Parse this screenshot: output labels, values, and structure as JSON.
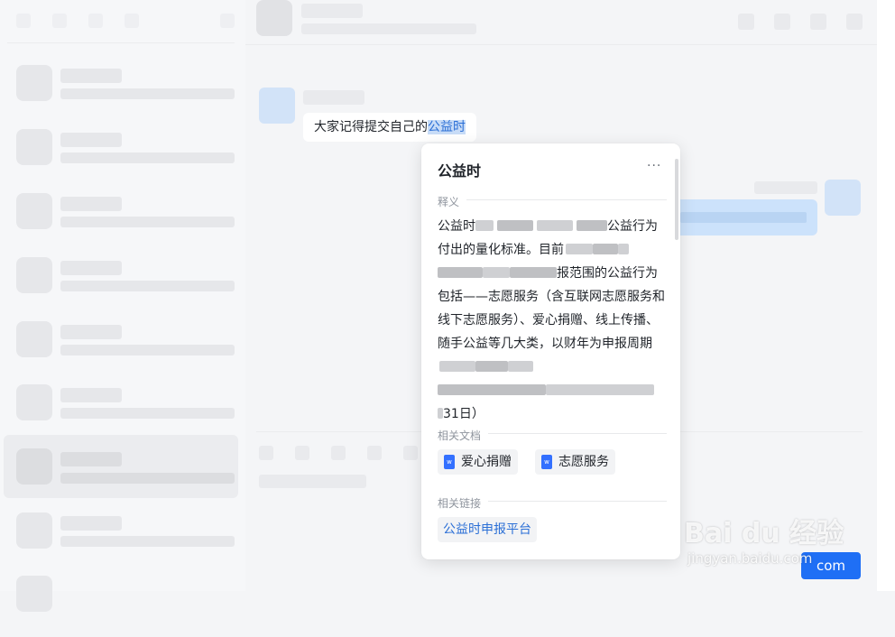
{
  "chat": {
    "message_prefix": "大家记得提交自己的",
    "message_highlight": "公益时"
  },
  "popup": {
    "title": "公益时",
    "more": "···",
    "definition_label": "释义",
    "definition": {
      "p1": "公益时",
      "p2": "公益",
      "p3": "行为付出的量化标准。目前",
      "p4": "报范围的公益行",
      "p5": "为包括——志愿服务（含互联网志愿服务和线下志愿服务）、爱心捐赠、线上传播、随手公益等几大类，以财年为申报周期",
      "p6": "31日）"
    },
    "related_docs_label": "相关文档",
    "related_docs": [
      "爱心捐赠",
      "志愿服务"
    ],
    "doc_icon_letter": "w",
    "related_links_label": "相关链接",
    "related_link": "公益时申报平台"
  },
  "send_button": "com",
  "watermark": {
    "main": "Bai du 经验",
    "url": "jingyan.baidu.com"
  },
  "colors": {
    "accent": "#1f6ff5",
    "highlight_bg": "#c8dcf7",
    "link": "#2b6fd6"
  }
}
